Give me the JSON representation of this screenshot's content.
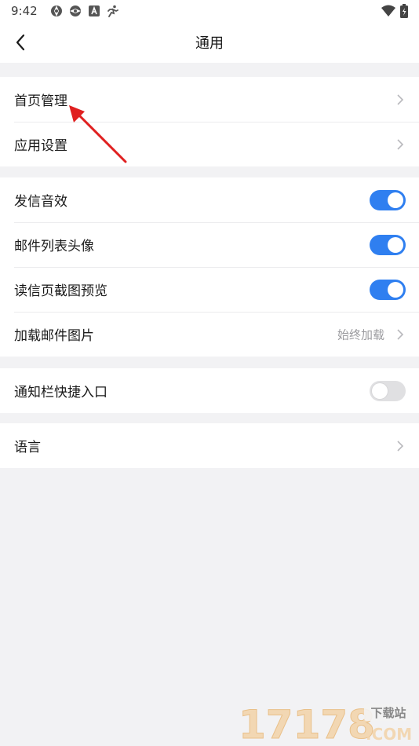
{
  "status_bar": {
    "time": "9:42",
    "icons": [
      "aperture-icon",
      "aperture-icon",
      "a-icon",
      "running-icon"
    ],
    "right_icons": [
      "wifi-icon",
      "battery-icon"
    ]
  },
  "header": {
    "title": "通用",
    "back_icon": "chevron-left-icon"
  },
  "groups": [
    {
      "rows": [
        {
          "label": "首页管理",
          "type": "chevron"
        },
        {
          "label": "应用设置",
          "type": "chevron"
        }
      ]
    },
    {
      "rows": [
        {
          "label": "发信音效",
          "type": "toggle",
          "on": true
        },
        {
          "label": "邮件列表头像",
          "type": "toggle",
          "on": true
        },
        {
          "label": "读信页截图预览",
          "type": "toggle",
          "on": true
        },
        {
          "label": "加载邮件图片",
          "type": "chevron",
          "value": "始终加载"
        }
      ]
    },
    {
      "rows": [
        {
          "label": "通知栏快捷入口",
          "type": "toggle",
          "on": false
        }
      ]
    },
    {
      "rows": [
        {
          "label": "语言",
          "type": "chevron"
        }
      ]
    }
  ],
  "colors": {
    "accent": "#2f7ff0",
    "background": "#f2f2f4",
    "annotation_arrow": "#e02020"
  },
  "watermark": {
    "number": "17178",
    "badge": "下载站",
    "suffix": ".COM"
  }
}
